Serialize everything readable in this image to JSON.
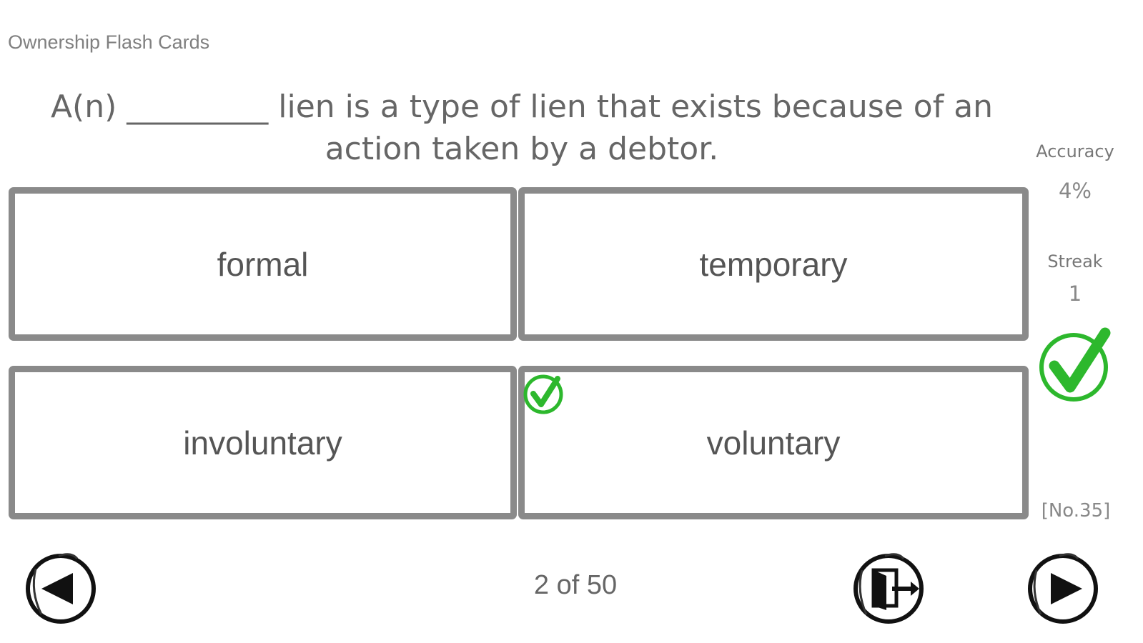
{
  "app": {
    "title": "Ownership Flash Cards"
  },
  "question": {
    "text": "A(n) _________ lien is a type of lien that exists because of an action taken by a debtor."
  },
  "answers": [
    {
      "label": "formal"
    },
    {
      "label": "temporary"
    },
    {
      "label": "involuntary"
    },
    {
      "label": "voluntary",
      "marked_correct": true
    }
  ],
  "stats": {
    "accuracy_label": "Accuracy",
    "accuracy_value": "4%",
    "streak_label": "Streak",
    "streak_value": "1",
    "card_id": "[No.35]"
  },
  "nav": {
    "progress": "2 of 50",
    "prev_icon": "play-left-icon",
    "exit_icon": "exit-door-icon",
    "next_icon": "play-right-icon"
  },
  "colors": {
    "correct": "#2db82d",
    "border": "#8a8a8a"
  }
}
